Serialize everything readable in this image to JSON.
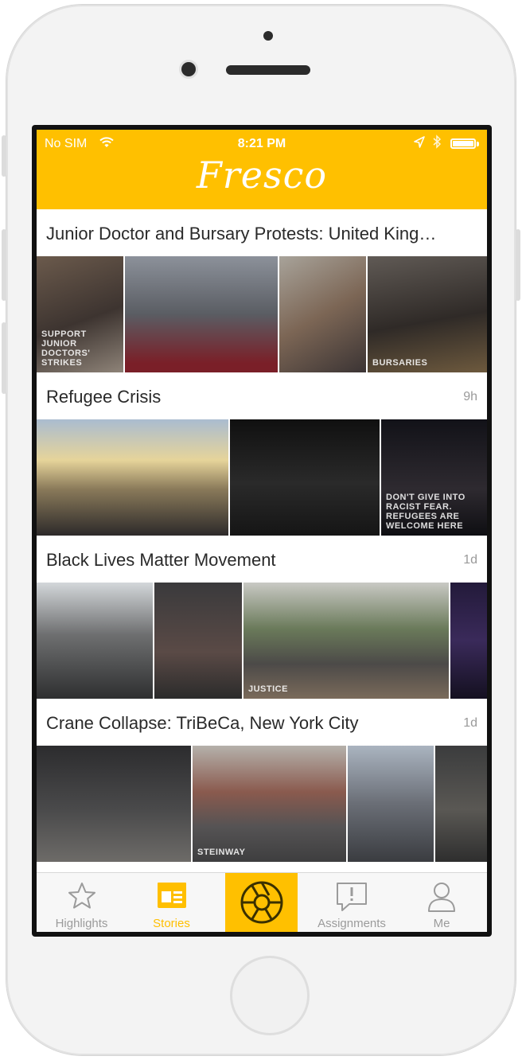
{
  "status_bar": {
    "carrier": "No SIM",
    "time": "8:21 PM"
  },
  "app": {
    "logo_text": "Fresco",
    "brand_color": "#ffc000"
  },
  "stories": [
    {
      "title": "Junior Doctor and Bursary Protests: United King…",
      "age": "",
      "photos": [
        {
          "caption": "SUPPORT JUNIOR DOCTORS' STRIKES",
          "color": "#5a4a40"
        },
        {
          "caption": "",
          "color": "#6d7078"
        },
        {
          "caption": "",
          "color": "#8a7768"
        },
        {
          "caption": "BURSARIES",
          "color": "#3b3632"
        }
      ]
    },
    {
      "title": "Refugee Crisis",
      "age": "9h",
      "photos": [
        {
          "caption": "",
          "color": "#8b8a7a"
        },
        {
          "caption": "",
          "color": "#1c1c1c"
        },
        {
          "caption": "DON'T GIVE INTO RACIST FEAR. REFUGEES ARE WELCOME HERE",
          "color": "#1a1a22"
        }
      ]
    },
    {
      "title": "Black Lives Matter Movement",
      "age": "1d",
      "photos": [
        {
          "caption": "",
          "color": "#5b5e5f"
        },
        {
          "caption": "",
          "color": "#4a4644"
        },
        {
          "caption": "JUSTICE",
          "color": "#6a6f5e"
        },
        {
          "caption": "",
          "color": "#2a2040"
        }
      ]
    },
    {
      "title": "Crane Collapse: TriBeCa, New York City",
      "age": "1d",
      "photos": [
        {
          "caption": "",
          "color": "#3b3b3c"
        },
        {
          "caption": "STEINWAY",
          "color": "#6e6a64"
        },
        {
          "caption": "",
          "color": "#5b5f66"
        },
        {
          "caption": "",
          "color": "#4c4c4a"
        }
      ]
    }
  ],
  "tab_bar": {
    "items": [
      {
        "label": "Highlights",
        "icon": "star-icon",
        "active": false
      },
      {
        "label": "Stories",
        "icon": "stories-icon",
        "active": true
      },
      {
        "label": "",
        "icon": "camera-aperture-icon",
        "active": false
      },
      {
        "label": "Assignments",
        "icon": "assignment-speech-icon",
        "active": false
      },
      {
        "label": "Me",
        "icon": "user-icon",
        "active": false
      }
    ],
    "active_color": "#ffbf00",
    "inactive_color": "#9b9b9b"
  }
}
